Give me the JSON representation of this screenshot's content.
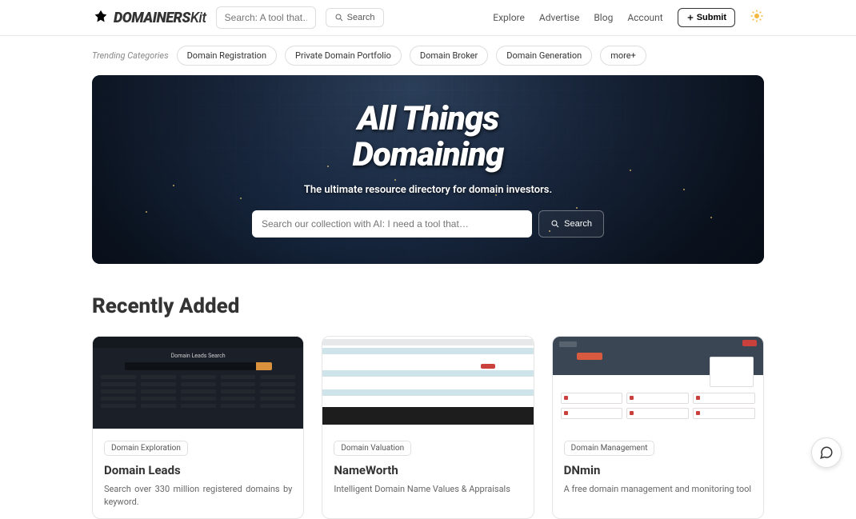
{
  "header": {
    "logo_main": "DOMAINERS",
    "logo_sub": "Kit",
    "search_placeholder": "Search: A tool that…",
    "search_btn": "Search",
    "nav": {
      "explore": "Explore",
      "advertise": "Advertise",
      "blog": "Blog",
      "account": "Account"
    },
    "submit": "Submit"
  },
  "categories": {
    "label": "Trending Categories",
    "items": [
      "Domain Registration",
      "Private Domain Portfolio",
      "Domain Broker",
      "Domain Generation",
      "more+"
    ]
  },
  "hero": {
    "title_l1": "All Things",
    "title_l2": "Domaining",
    "subtitle": "The ultimate resource directory for domain investors.",
    "search_placeholder": "Search our collection with AI: I need a tool that…",
    "search_btn": "Search"
  },
  "section_title": "Recently Added",
  "cards": [
    {
      "tag": "Domain Exploration",
      "title": "Domain Leads",
      "desc": "Search over 330 million registered domains by keyword."
    },
    {
      "tag": "Domain Valuation",
      "title": "NameWorth",
      "desc": "Intelligent Domain Name Values & Appraisals"
    },
    {
      "tag": "Domain Management",
      "title": "DNmin",
      "desc": "A free domain management and monitoring tool"
    }
  ]
}
